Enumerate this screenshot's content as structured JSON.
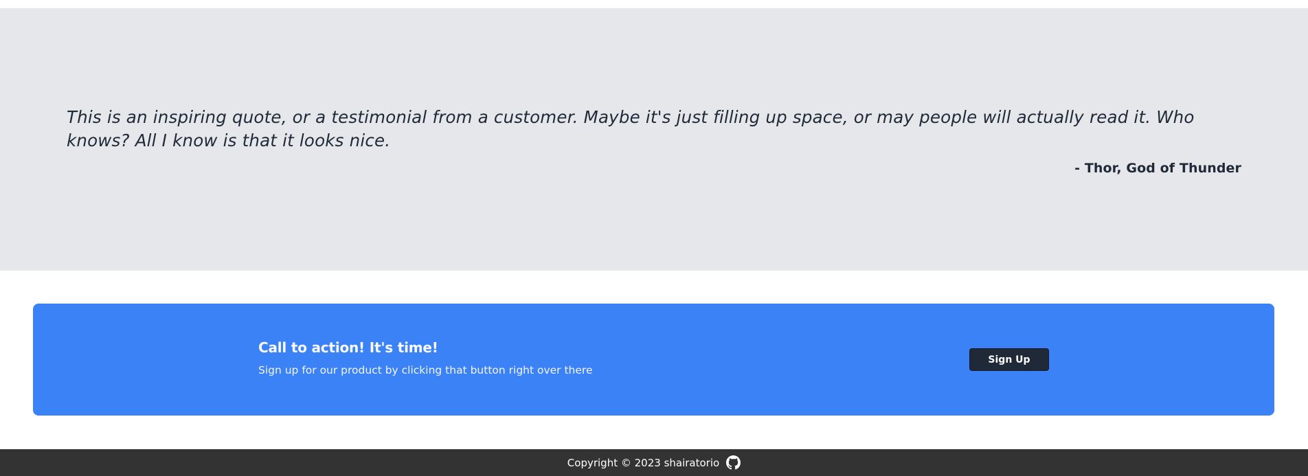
{
  "testimonial": {
    "quote": "This is an inspiring quote, or a testimonial from a customer. Maybe it's just filling up space, or may people will actually read it. Who knows? All I know is that it looks nice.",
    "author": "- Thor, God of Thunder"
  },
  "cta": {
    "title": "Call to action! It's time!",
    "subtitle": "Sign up for our product by clicking that button right over there",
    "button_label": "Sign Up"
  },
  "footer": {
    "copyright": "Copyright © 2023 shairatorio",
    "icon": "github-icon"
  },
  "colors": {
    "quote_background": "#e5e7eb",
    "cta_background": "#3b82f6",
    "button_background": "#1f2937",
    "footer_background": "#333333"
  }
}
